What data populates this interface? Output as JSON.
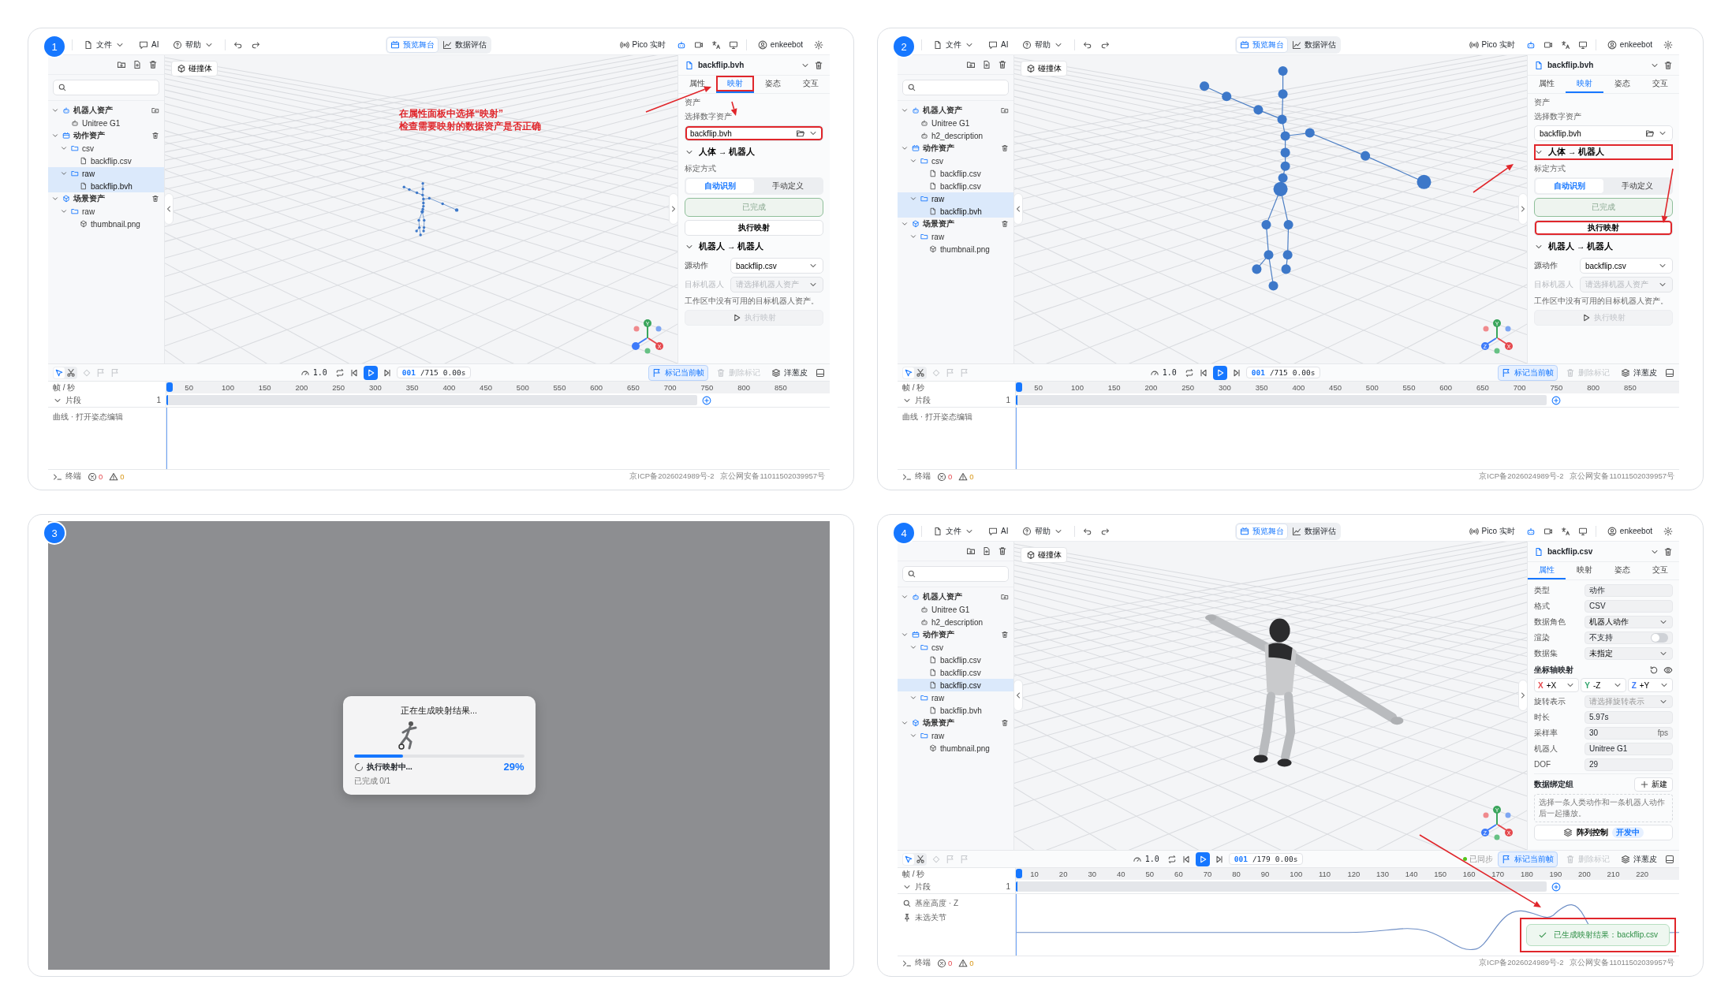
{
  "panels": [
    {
      "badge": "1",
      "kind": "app",
      "toolbar": {
        "menus": [
          {
            "label": "文件",
            "dropdown": true
          },
          {
            "label": "AI",
            "dropdown": false
          },
          {
            "label": "帮助",
            "dropdown": true
          }
        ],
        "modes": [
          {
            "label": "预览舞台",
            "selected": true
          },
          {
            "label": "数据评估",
            "selected": false
          }
        ],
        "live": "Pico 实时",
        "user": "enkeebot"
      },
      "tree": [
        {
          "label": "机器人资产",
          "kind": "robot-group",
          "expanded": true,
          "selected": false,
          "children": [
            {
              "label": "Unitree G1",
              "kind": "robot",
              "selected": false
            }
          ]
        },
        {
          "label": "动作资产",
          "kind": "motion-group",
          "expanded": true,
          "selected": false,
          "children": [
            {
              "label": "csv",
              "kind": "folder",
              "expanded": true,
              "selected": false,
              "children": [
                {
                  "label": "backflip.csv",
                  "kind": "file",
                  "selected": false
                }
              ]
            },
            {
              "label": "raw",
              "kind": "folder",
              "expanded": true,
              "selected": true,
              "children": [
                {
                  "label": "backflip.bvh",
                  "kind": "file",
                  "selected": true
                }
              ]
            }
          ]
        },
        {
          "label": "场景资产",
          "kind": "scene-group",
          "expanded": true,
          "selected": false,
          "children": [
            {
              "label": "raw",
              "kind": "folder",
              "expanded": true,
              "selected": false,
              "children": [
                {
                  "label": "thumbnail.png",
                  "kind": "model",
                  "selected": false
                }
              ]
            }
          ]
        }
      ],
      "viewport": {
        "collider": "碰撞体",
        "kind": "small-skeleton",
        "gizmo": {
          "y": "Y",
          "x": "X"
        }
      },
      "callout": [
        "在属性面板中选择“映射”",
        "检查需要映射的数据资产是否正确"
      ],
      "inspector": {
        "kind": "mapping",
        "file": "backflip.bvh",
        "tabs": [
          {
            "label": "属性",
            "selected": false,
            "highlighted": false
          },
          {
            "label": "映射",
            "selected": true,
            "highlighted": true
          },
          {
            "label": "姿态",
            "selected": false,
            "highlighted": false
          },
          {
            "label": "交互",
            "selected": false,
            "highlighted": false
          }
        ],
        "asset": {
          "heading": "资产",
          "label": "选择数字资产",
          "value": "backflip.bvh",
          "highlighted": true
        },
        "human_to_robot": {
          "title": "人体 → 机器人",
          "expanded": true,
          "highlighted": false,
          "method_label": "标定方式",
          "methods": [
            {
              "label": "自动识别",
              "selected": true
            },
            {
              "label": "手动定义",
              "selected": false
            }
          ],
          "status": "已完成",
          "run": {
            "label": "执行映射",
            "highlighted": false
          }
        },
        "robot_to_robot": {
          "title": "机器人 → 机器人",
          "expanded": true,
          "source_label": "源动作",
          "source": "backflip.csv",
          "target_label": "目标机器人",
          "target_placeholder": "请选择机器人资产",
          "target_disabled": true,
          "note": "工作区中没有可用的目标机器人资产。",
          "run": {
            "label": "执行映射",
            "disabled": true
          }
        }
      },
      "timeline": {
        "speed": "1.0",
        "frame": "001",
        "total": "/715",
        "time": "0.00s",
        "mark": "标记当前帧",
        "unmark": "删除标记",
        "onion": "洋葱皮",
        "unit_label": "帧 / 秒",
        "ticks": [
          "50",
          "100",
          "150",
          "200",
          "250",
          "300",
          "350",
          "400",
          "450",
          "500",
          "550",
          "600",
          "650",
          "700",
          "750",
          "800",
          "850"
        ],
        "clip_label": "片段",
        "clip_count": "1",
        "tracks": [
          {
            "kind": "hint",
            "label": "曲线 · 打开姿态编辑"
          }
        ],
        "curve": false,
        "tools": [
          {
            "kind": "select",
            "selected": true
          },
          {
            "kind": "cut",
            "selected": false
          }
        ]
      },
      "status": {
        "terminal": "终端",
        "errors": "0",
        "warnings": "0",
        "icp": "京ICP备2026024989号-2",
        "police": "京公网安备11011502039957号"
      }
    },
    {
      "badge": "2",
      "kind": "app",
      "toolbar": {
        "menus": [
          {
            "label": "文件",
            "dropdown": true
          },
          {
            "label": "AI",
            "dropdown": false
          },
          {
            "label": "帮助",
            "dropdown": true
          }
        ],
        "modes": [
          {
            "label": "预览舞台",
            "selected": true
          },
          {
            "label": "数据评估",
            "selected": false
          }
        ],
        "live": "Pico 实时",
        "user": "enkeebot"
      },
      "tree": [
        {
          "label": "机器人资产",
          "kind": "robot-group",
          "expanded": true,
          "selected": false,
          "children": [
            {
              "label": "Unitree G1",
              "kind": "robot",
              "selected": false
            },
            {
              "label": "h2_description",
              "kind": "robot",
              "selected": false
            }
          ]
        },
        {
          "label": "动作资产",
          "kind": "motion-group",
          "expanded": true,
          "selected": false,
          "children": [
            {
              "label": "csv",
              "kind": "folder",
              "expanded": true,
              "selected": false,
              "children": [
                {
                  "label": "backflip.csv",
                  "kind": "file",
                  "selected": false
                },
                {
                  "label": "backflip.csv",
                  "kind": "file",
                  "selected": false
                }
              ]
            },
            {
              "label": "raw",
              "kind": "folder",
              "expanded": true,
              "selected": true,
              "children": [
                {
                  "label": "backflip.bvh",
                  "kind": "file",
                  "selected": true
                }
              ]
            }
          ]
        },
        {
          "label": "场景资产",
          "kind": "scene-group",
          "expanded": true,
          "selected": false,
          "children": [
            {
              "label": "raw",
              "kind": "folder",
              "expanded": true,
              "selected": false,
              "children": [
                {
                  "label": "thumbnail.png",
                  "kind": "model",
                  "selected": false
                }
              ]
            }
          ]
        }
      ],
      "viewport": {
        "collider": "碰撞体",
        "kind": "large-skeleton",
        "gizmo": {
          "y": "Y",
          "x": "X",
          "z": "Z"
        }
      },
      "inspector": {
        "kind": "mapping",
        "file": "backflip.bvh",
        "tabs": [
          {
            "label": "属性",
            "selected": false,
            "highlighted": false
          },
          {
            "label": "映射",
            "selected": true,
            "highlighted": false
          },
          {
            "label": "姿态",
            "selected": false,
            "highlighted": false
          },
          {
            "label": "交互",
            "selected": false,
            "highlighted": false
          }
        ],
        "asset": {
          "heading": "资产",
          "label": "选择数字资产",
          "value": "backflip.bvh",
          "highlighted": false
        },
        "human_to_robot": {
          "title": "人体 → 机器人",
          "expanded": true,
          "highlighted": true,
          "method_label": "标定方式",
          "methods": [
            {
              "label": "自动识别",
              "selected": true
            },
            {
              "label": "手动定义",
              "selected": false
            }
          ],
          "status": "已完成",
          "run": {
            "label": "执行映射",
            "highlighted": true
          }
        },
        "robot_to_robot": {
          "title": "机器人 → 机器人",
          "expanded": true,
          "source_label": "源动作",
          "source": "backflip.csv",
          "target_label": "目标机器人",
          "target_placeholder": "请选择机器人资产",
          "target_disabled": true,
          "note": "工作区中没有可用的目标机器人资产。",
          "run": {
            "label": "执行映射",
            "disabled": true
          }
        }
      },
      "timeline": {
        "speed": "1.0",
        "frame": "001",
        "total": "/715",
        "time": "0.00s",
        "mark": "标记当前帧",
        "unmark": "删除标记",
        "onion": "洋葱皮",
        "unit_label": "帧 / 秒",
        "ticks": [
          "50",
          "100",
          "150",
          "200",
          "250",
          "300",
          "350",
          "400",
          "450",
          "500",
          "550",
          "600",
          "650",
          "700",
          "750",
          "800",
          "850"
        ],
        "clip_label": "片段",
        "clip_count": "1",
        "tracks": [
          {
            "kind": "hint",
            "label": "曲线 · 打开姿态编辑"
          }
        ],
        "curve": false,
        "tools": [
          {
            "kind": "select",
            "selected": true
          },
          {
            "kind": "cut",
            "selected": false
          }
        ]
      },
      "status": {
        "terminal": "终端",
        "errors": "0",
        "warnings": "0",
        "icp": "京ICP备2026024989号-2",
        "police": "京公网安备11011502039957号"
      }
    },
    {
      "badge": "3",
      "kind": "progress",
      "dialog": {
        "title": "正在生成映射结果...",
        "level": 0.29,
        "status": "执行映射中...",
        "percent": "29%",
        "done": "已完成 0/1"
      }
    },
    {
      "badge": "4",
      "kind": "app",
      "toolbar": {
        "menus": [
          {
            "label": "文件",
            "dropdown": true
          },
          {
            "label": "AI",
            "dropdown": false
          },
          {
            "label": "帮助",
            "dropdown": true
          }
        ],
        "modes": [
          {
            "label": "预览舞台",
            "selected": true
          },
          {
            "label": "数据评估",
            "selected": false
          }
        ],
        "live": "Pico 实时",
        "user": "enkeebot"
      },
      "tree": [
        {
          "label": "机器人资产",
          "kind": "robot-group",
          "expanded": true,
          "selected": false,
          "children": [
            {
              "label": "Unitree G1",
              "kind": "robot",
              "selected": false
            },
            {
              "label": "h2_description",
              "kind": "robot",
              "selected": false
            }
          ]
        },
        {
          "label": "动作资产",
          "kind": "motion-group",
          "expanded": true,
          "selected": false,
          "children": [
            {
              "label": "csv",
              "kind": "folder",
              "expanded": true,
              "selected": false,
              "children": [
                {
                  "label": "backflip.csv",
                  "kind": "file",
                  "selected": false
                },
                {
                  "label": "backflip.csv",
                  "kind": "file",
                  "selected": false
                },
                {
                  "label": "backflip.csv",
                  "kind": "file",
                  "selected": true
                }
              ]
            },
            {
              "label": "raw",
              "kind": "folder",
              "expanded": true,
              "selected": false,
              "children": [
                {
                  "label": "backflip.bvh",
                  "kind": "file",
                  "selected": false
                }
              ]
            }
          ]
        },
        {
          "label": "场景资产",
          "kind": "scene-group",
          "expanded": true,
          "selected": false,
          "children": [
            {
              "label": "raw",
              "kind": "folder",
              "expanded": true,
              "selected": false,
              "children": [
                {
                  "label": "thumbnail.png",
                  "kind": "model",
                  "selected": false
                }
              ]
            }
          ]
        }
      ],
      "viewport": {
        "collider": "碰撞体",
        "kind": "robot",
        "gizmo": {
          "y": "Y",
          "x": "X",
          "z": "Z"
        }
      },
      "inspector": {
        "kind": "properties",
        "file": "backflip.csv",
        "tabs": [
          {
            "label": "属性",
            "selected": true,
            "highlighted": false
          },
          {
            "label": "映射",
            "selected": false,
            "highlighted": false
          },
          {
            "label": "姿态",
            "selected": false,
            "highlighted": false
          },
          {
            "label": "交互",
            "selected": false,
            "highlighted": false
          }
        ],
        "fields": [
          {
            "kind": "text",
            "label": "类型",
            "value": "动作"
          },
          {
            "kind": "text",
            "label": "格式",
            "value": "CSV"
          },
          {
            "kind": "select",
            "label": "数据角色",
            "value": "机器人动作"
          },
          {
            "kind": "toggle",
            "label": "渲染",
            "value": "不支持",
            "on": false
          },
          {
            "kind": "select",
            "label": "数据集",
            "value": "未指定"
          }
        ],
        "axis_mapping": {
          "title": "坐标轴映射",
          "axes": [
            {
              "axis": "X",
              "value": "+X",
              "color": "#e5484d"
            },
            {
              "axis": "Y",
              "value": "-Z",
              "color": "#30a46c"
            },
            {
              "axis": "Z",
              "value": "+Y",
              "color": "#3e7bfa"
            }
          ]
        },
        "fields2": [
          {
            "kind": "select",
            "label": "旋转表示",
            "placeholder": "请选择旋转表示"
          },
          {
            "kind": "text",
            "label": "时长",
            "value": "5.97s"
          },
          {
            "kind": "unit",
            "label": "采样率",
            "value": "30",
            "unit": "fps"
          },
          {
            "kind": "text",
            "label": "机器人",
            "value": "Unitree G1"
          },
          {
            "kind": "text",
            "label": "DOF",
            "value": "29"
          }
        ],
        "binding": {
          "title": "数据绑定组",
          "new": "新建",
          "hint": "选择一条人类动作和一条机器人动作后一起播放。"
        },
        "array": {
          "label": "阵列控制",
          "badge": "开发中"
        }
      },
      "timeline": {
        "tools": [
          {
            "kind": "select",
            "selected": true
          },
          {
            "kind": "cut",
            "selected": false
          }
        ],
        "speed": "1.0",
        "frame": "001",
        "total": "/179",
        "time": "0.00s",
        "synced": "已同步",
        "mark": "标记当前帧",
        "unmark": "删除标记",
        "onion": "洋葱皮",
        "unit_label": "帧 / 秒",
        "ticks": [
          "10",
          "20",
          "30",
          "40",
          "50",
          "60",
          "70",
          "80",
          "90",
          "100",
          "110",
          "120",
          "130",
          "140",
          "150",
          "160",
          "170",
          "180",
          "190",
          "200",
          "210",
          "220"
        ],
        "clip_label": "片段",
        "clip_count": "1",
        "tracks": [
          {
            "kind": "search",
            "label": "基座高度 · Z"
          },
          {
            "kind": "pin",
            "label": "未选关节"
          }
        ],
        "curve": true
      },
      "toast": {
        "text": "已生成映射结果：backflip.csv",
        "highlighted": true
      },
      "status": {
        "terminal": "终端",
        "errors": "0",
        "warnings": "0",
        "icp": "京ICP备2026024989号-2",
        "police": "京公网安备11011502039957号"
      }
    }
  ]
}
